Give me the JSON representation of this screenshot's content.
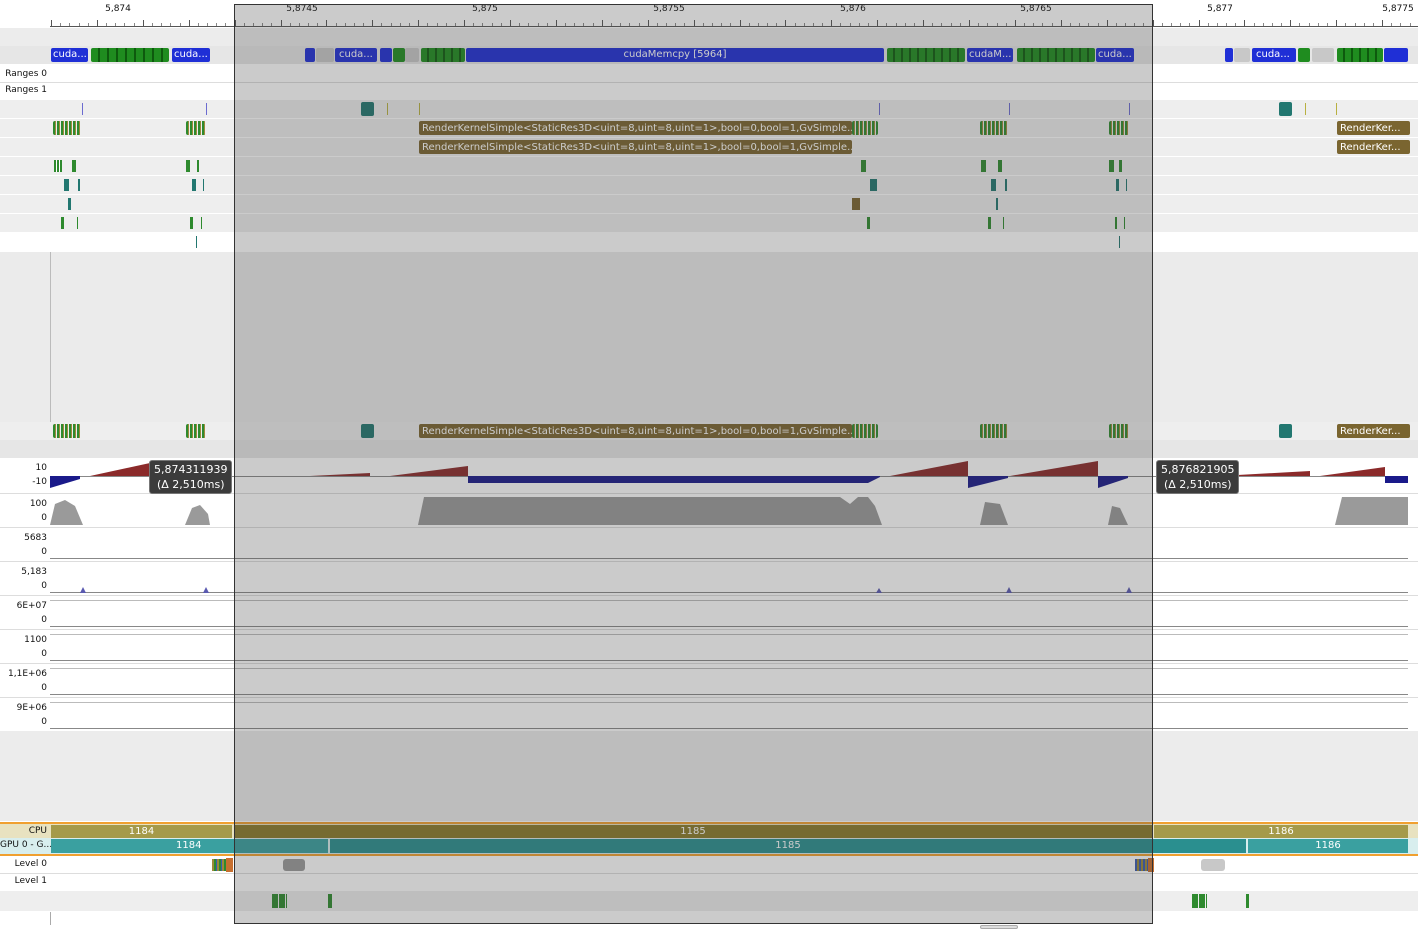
{
  "ruler": {
    "ticks": [
      "5,874",
      "5,8745",
      "5,875",
      "5,8755",
      "5,876",
      "5,8765",
      "5,877",
      "5,8775"
    ]
  },
  "rows": {
    "ranges0": "Ranges 0",
    "ranges1": "Ranges 1"
  },
  "cuda_labels": {
    "a1": "cuda...",
    "a2": "cuda...",
    "b1": "cuda...",
    "memcpy": "cudaMemcpy [5964]",
    "c1": "cudaM...",
    "c2": "cuda...",
    "d1": "cuda..."
  },
  "kernels": {
    "k1": "RenderKernelSimple<StaticRes3D<uint=8,uint=8,uint=1>,bool=0,bool=1,GvSimple...",
    "k2": "RenderKernelSimple<StaticRes3D<uint=8,uint=8,uint=1>,bool=0,bool=1,GvSimple...",
    "k3": "RenderKernelSimple<StaticRes3D<uint=8,uint=8,uint=1>,bool=0,bool=1,GvSimple...",
    "r1": "RenderKer...",
    "r2": "RenderKer...",
    "r3": "RenderKer..."
  },
  "metrics": [
    {
      "top": "10",
      "bottom": "-10"
    },
    {
      "top": "100",
      "bottom": "0"
    },
    {
      "top": "5683",
      "bottom": "0"
    },
    {
      "top": "5,183",
      "bottom": "0"
    },
    {
      "top": "6E+07",
      "bottom": "0"
    },
    {
      "top": "1100",
      "bottom": "0"
    },
    {
      "top": "1,1E+06",
      "bottom": "0"
    },
    {
      "top": "9E+06",
      "bottom": "0"
    }
  ],
  "markers": {
    "left_time": "5,874311939",
    "left_delta": "(Δ 2,510ms)",
    "right_time": "5,876821905",
    "right_delta": "(Δ 2,510ms)"
  },
  "frames": {
    "cpu_label": "CPU",
    "gpu_label": "GPU 0 - G...",
    "cpu_frames": [
      "1184",
      "1185",
      "1186"
    ],
    "gpu_frames": [
      "1184",
      "1185",
      "1186"
    ]
  },
  "levels": {
    "level0": "Level 0",
    "level1": "Level 1"
  },
  "colors": {
    "cpu": "#8a7a2a",
    "gpu": "#2a8f8f",
    "selection_border": "#333333",
    "accent": "#f0a030"
  }
}
